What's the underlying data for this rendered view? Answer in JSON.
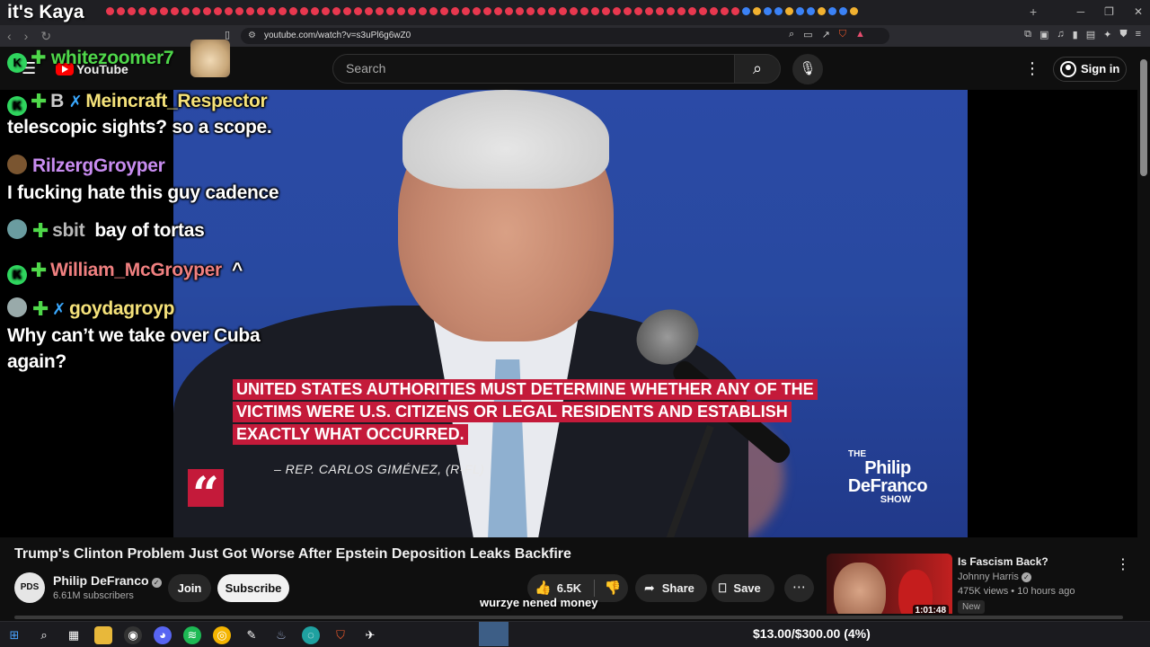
{
  "browser": {
    "url": "youtube.com/watch?v=s3uPl6g6wZ0",
    "tab_count_icons": 70
  },
  "youtube": {
    "logo_text": "YouTube",
    "search_placeholder": "Search",
    "signin_label": "Sign in"
  },
  "stream_overlay": {
    "top_text": "it's Kaya",
    "top_user": "whitezoomer7",
    "bottom_caption": "wurzye nened money",
    "chat": [
      {
        "user": "Meincraft_Respector",
        "user_color": "#f5e27a",
        "message": "",
        "prefix": "B"
      },
      {
        "user": "",
        "user_color": "#ffffff",
        "message": "telescopic sights? so a scope."
      },
      {
        "user": "RilzergGroyper",
        "user_color": "#c88cf0",
        "message": ""
      },
      {
        "user": "",
        "user_color": "#ffffff",
        "message": "I fucking hate this guy cadence"
      },
      {
        "user": "sbit",
        "user_color": "#c0c0c0",
        "message": "bay of tortas"
      },
      {
        "user": "William_McGroyper",
        "user_color": "#f08080",
        "message": "^"
      },
      {
        "user": "goydagroyp",
        "user_color": "#f5e27a",
        "message": ""
      },
      {
        "user": "",
        "user_color": "#ffffff",
        "message": "Why can’t we take over Cuba"
      },
      {
        "user": "",
        "user_color": "#ffffff",
        "message": "again?"
      }
    ]
  },
  "video": {
    "quote_lines": [
      "UNITED STATES AUTHORITIES MUST DETERMINE WHETHER ANY OF THE",
      "VICTIMS WERE U.S. CITIZENS OR LEGAL RESIDENTS AND ESTABLISH",
      "EXACTLY WHAT OCCURRED."
    ],
    "quote_mark": "“",
    "attribution": "– REP. CARLOS GIMÉNEZ, (R-FL)",
    "show_logo": {
      "l1": "THE",
      "l2": "Philip",
      "l3": "DeFranco",
      "l4": "SHOW"
    },
    "accent_color": "#c41a3a"
  },
  "meta": {
    "title": "Trump's Clinton Problem Just Got Worse After Epstein Deposition Leaks Backfire",
    "channel": "Philip DeFranco",
    "channel_avatar_text": "PDS",
    "subscribers": "6.61M subscribers",
    "join_label": "Join",
    "subscribe_label": "Subscribe",
    "likes": "6.5K",
    "share_label": "Share",
    "save_label": "Save"
  },
  "recommended": {
    "title": "Is Fascism Back?",
    "channel": "Johnny Harris",
    "views_time": "475K views • 10 hours ago",
    "badge": "New",
    "duration": "1:01:48"
  },
  "taskbar": {
    "donation_text": "$13.00/$300.00 (4%)"
  }
}
